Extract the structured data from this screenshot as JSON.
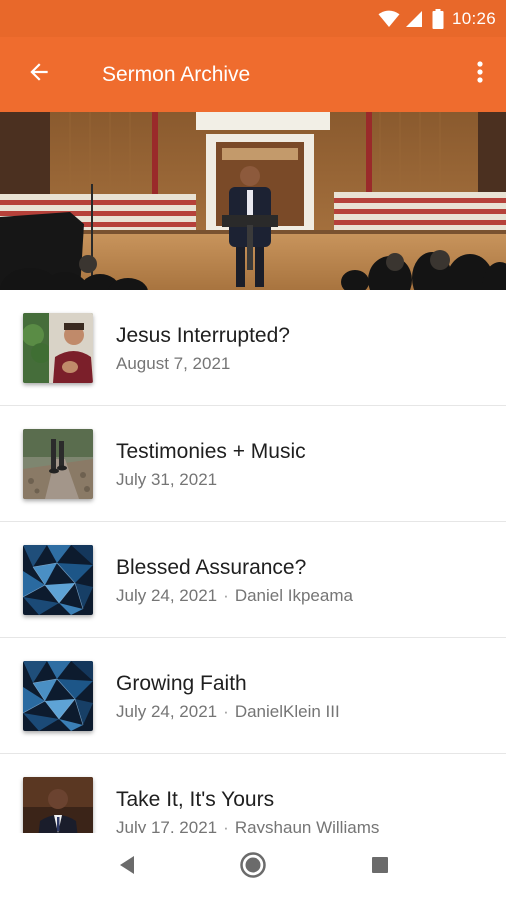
{
  "status_bar": {
    "time": "10:26",
    "icons": [
      "wifi-icon",
      "signal-icon",
      "battery-icon"
    ],
    "background": "#e8682a"
  },
  "app_bar": {
    "title": "Sermon Archive",
    "back_icon": "back-arrow-icon",
    "overflow_icon": "more-vert-icon",
    "background": "#ef6c2e"
  },
  "hero": {
    "image": "church-stage-speaker-photo"
  },
  "sermons": [
    {
      "title": "Jesus Interrupted?",
      "date": "August 7, 2021",
      "speaker": "",
      "thumbnail": "speaker-photo"
    },
    {
      "title": "Testimonies + Music",
      "date": "July 31, 2021",
      "speaker": "",
      "thumbnail": "path-photo"
    },
    {
      "title": "Blessed Assurance?",
      "date": "July 24, 2021",
      "speaker": "Daniel Ikpeama",
      "thumbnail": "blue-polygon-art"
    },
    {
      "title": "Growing Faith",
      "date": "July 24, 2021",
      "speaker": "DanielKlein III",
      "thumbnail": "blue-polygon-art"
    },
    {
      "title": "Take It, It's Yours",
      "date": "July 17, 2021",
      "speaker": "Rayshaun Williams",
      "thumbnail": "speaker-suit-photo"
    }
  ],
  "separator": "·",
  "nav_bar": {
    "buttons": [
      "back-triangle-icon",
      "home-circle-icon",
      "recents-square-icon"
    ]
  },
  "colors": {
    "primary": "#ef6c2e",
    "primary_dark": "#e8682a",
    "title_text": "#1f1f1f",
    "secondary_text": "#757575",
    "divider": "#e6e6e6"
  }
}
